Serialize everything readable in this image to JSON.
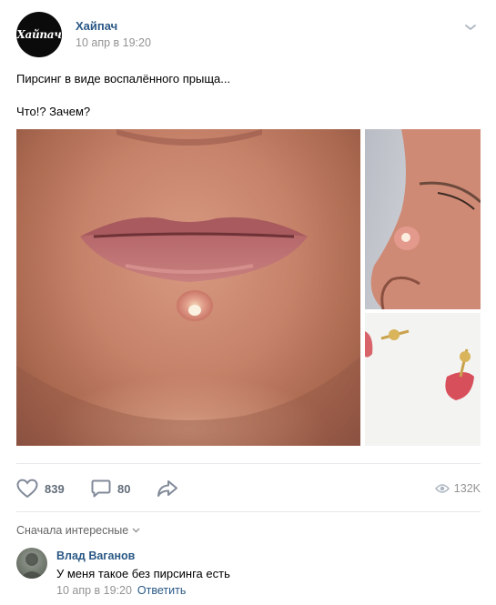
{
  "post": {
    "author": "Хайпач",
    "avatar_text": "Хайпач",
    "date": "10 апр в 19:20",
    "text_lines": [
      "Пирсинг в виде воспалённого прыща...",
      "Что!? Зачем?"
    ]
  },
  "actions": {
    "likes": "839",
    "comments": "80",
    "views": "132K"
  },
  "comments_section": {
    "sort_label": "Сначала интересные",
    "items": [
      {
        "author": "Влад Ваганов",
        "text": "У меня такое без пирсинга есть",
        "date": "10 апр в 19:20",
        "reply_label": "Ответить"
      }
    ]
  },
  "colors": {
    "link": "#2a5885",
    "muted": "#939393",
    "action": "#626d7a",
    "divider": "#e7e8ec"
  },
  "icons": [
    "chevron-down-icon",
    "heart-icon",
    "comment-icon",
    "share-icon",
    "eye-icon"
  ]
}
